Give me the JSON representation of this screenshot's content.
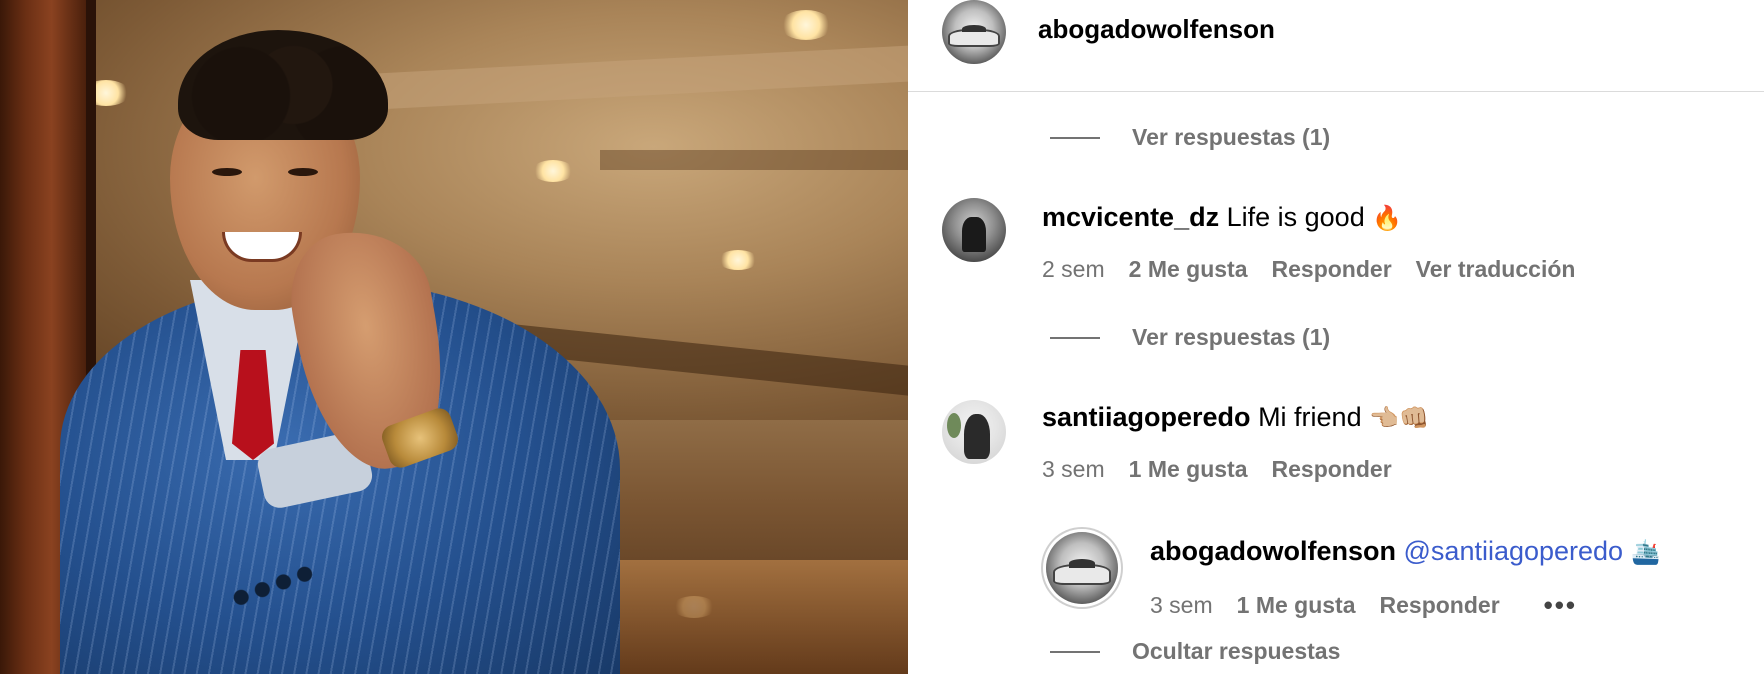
{
  "post": {
    "author": "abogadowolfenson"
  },
  "comments": [
    {
      "view_replies": "Ver respuestas (1)"
    },
    {
      "username": "mcvicente_dz",
      "text": "Life is good",
      "emoji": "🔥",
      "time": "2 sem",
      "likes": "2 Me gusta",
      "reply": "Responder",
      "translate": "Ver traducción",
      "view_replies": "Ver respuestas (1)"
    },
    {
      "username": "santiiagoperedo",
      "text": "Mi friend",
      "emoji": "👈🏼👊🏼",
      "time": "3 sem",
      "likes": "1 Me gusta",
      "reply": "Responder"
    }
  ],
  "reply": {
    "username": "abogadowolfenson",
    "mention": "@santiiagoperedo",
    "emoji": "🛳️",
    "time": "3 sem",
    "likes": "1 Me gusta",
    "reply": "Responder",
    "more": "•••",
    "hide_replies": "Ocultar respuestas"
  },
  "colors": {
    "secondary_text": "#737373",
    "mention": "#3b5ccc",
    "divider": "#dbdbdb"
  },
  "icons": {
    "more": "more-options-icon"
  }
}
